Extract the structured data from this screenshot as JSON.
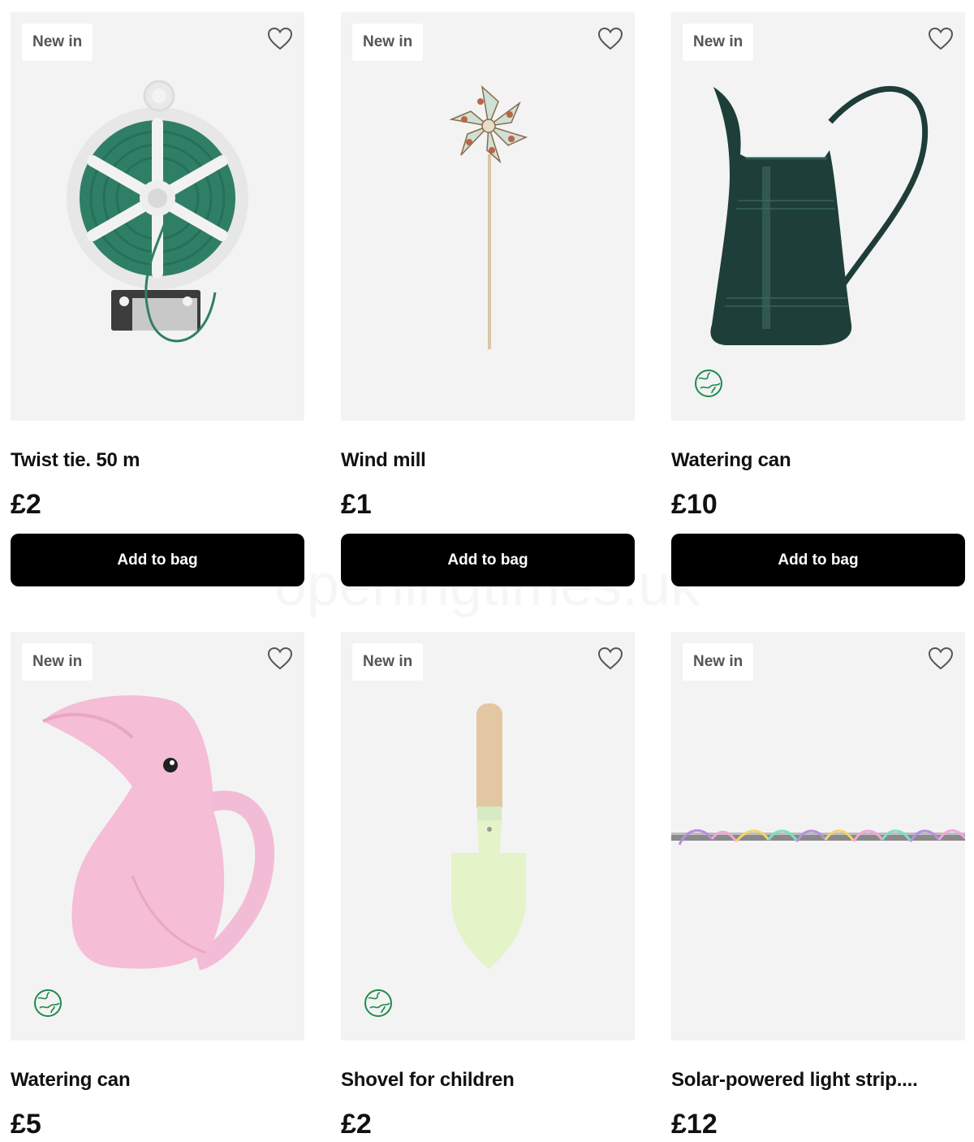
{
  "products": [
    {
      "badge": "New in",
      "title": "Twist tie. 50 m",
      "price": "£2",
      "button": "Add to bag",
      "eco": false,
      "image": "twist-tie-reel"
    },
    {
      "badge": "New in",
      "title": "Wind mill",
      "price": "£1",
      "button": "Add to bag",
      "eco": false,
      "image": "pinwheel"
    },
    {
      "badge": "New in",
      "title": "Watering can",
      "price": "£10",
      "button": "Add to bag",
      "eco": true,
      "image": "green-metal-jug"
    },
    {
      "badge": "New in",
      "title": "Watering can",
      "price": "£5",
      "eco": true,
      "image": "pink-toucan-watering-can"
    },
    {
      "badge": "New in",
      "title": "Shovel for children",
      "price": "£2",
      "eco": true,
      "image": "kids-trowel"
    },
    {
      "badge": "New in",
      "title": "Solar-powered light strip....",
      "price": "£12",
      "eco": false,
      "image": "led-light-strip"
    }
  ],
  "icons": {
    "favourite": "heart-outline-icon",
    "eco": "globe-eco-icon"
  },
  "colors": {
    "button_bg": "#000000",
    "button_text": "#ffffff",
    "card_bg": "#f3f3f3",
    "eco_green": "#1f8a4c"
  },
  "watermark": "openingtimes.uk"
}
